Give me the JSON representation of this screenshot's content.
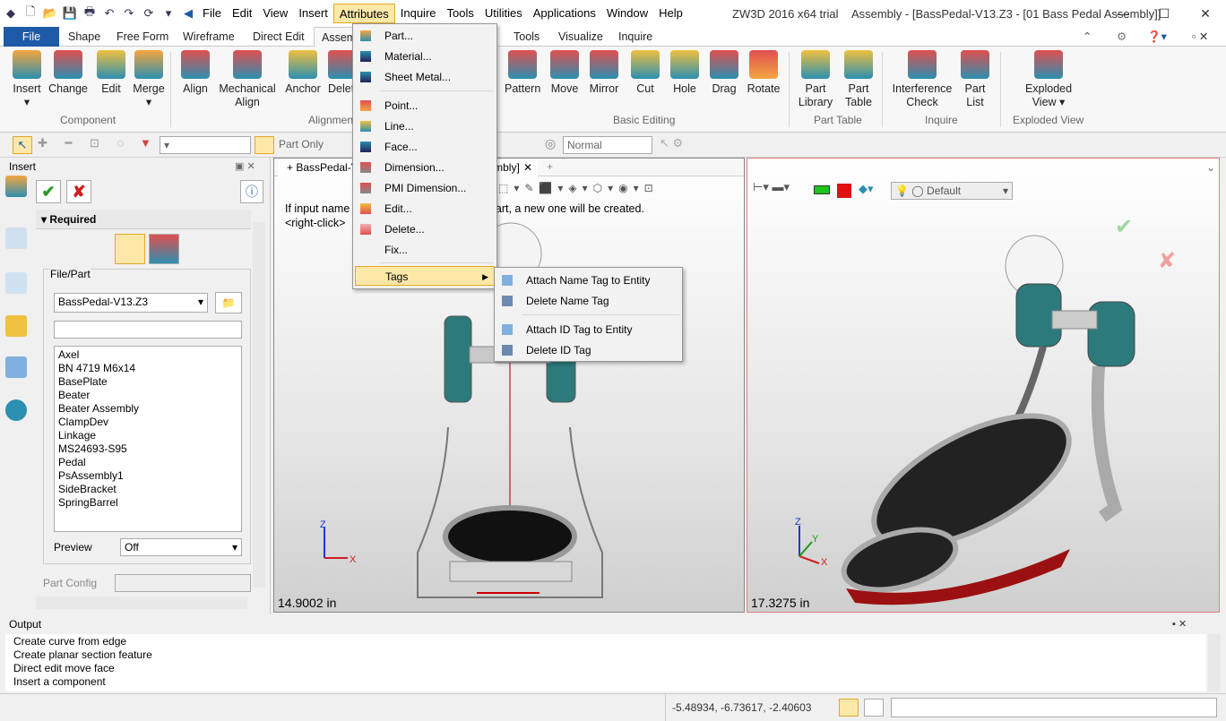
{
  "titlebar": {
    "menu": [
      "File",
      "Edit",
      "View",
      "Insert",
      "Attributes",
      "Inquire",
      "Tools",
      "Utilities",
      "Applications",
      "Window",
      "Help"
    ],
    "title": "ZW3D 2016  x64 trial",
    "doc": "Assembly - [BassPedal-V13.Z3 - [01 Bass Pedal Assembly]]"
  },
  "tabs": [
    "File",
    "Shape",
    "Free Form",
    "Wireframe",
    "Direct Edit",
    "Assembly",
    "Tools",
    "Visualize",
    "Inquire"
  ],
  "ribbon": {
    "component": [
      "Insert",
      "Change",
      "Edit",
      "Merge"
    ],
    "alignment": [
      "Align",
      "Mechanical Align",
      "Anchor",
      "Delete"
    ],
    "basic": [
      "Pattern",
      "Move",
      "Mirror",
      "Cut",
      "Hole",
      "Drag",
      "Rotate"
    ],
    "parttable": [
      "Part Library",
      "Part Table"
    ],
    "inquire": [
      "Interference Check",
      "Part List"
    ],
    "exploded": [
      "Exploded View"
    ],
    "groups": {
      "component": "Component",
      "alignment": "Alignment",
      "basic": "Basic Editing",
      "parttable": "Part Table",
      "inquire": "Inquire",
      "exploded": "Exploded View"
    }
  },
  "toolbar": {
    "partonly": "Part Only",
    "normal": "Normal",
    "default": "Default"
  },
  "panel": {
    "title": "Insert",
    "required": "Required",
    "filepart": "File/Part",
    "file": "BassPedal-V13.Z3",
    "parts": [
      "Axel",
      "BN 4719 M6x14",
      "BasePlate",
      "Beater",
      "Beater Assembly",
      "ClampDev",
      "Linkage",
      "MS24693-S95",
      "Pedal",
      "PsAssembly1",
      "SideBracket",
      "SpringBarrel"
    ],
    "preview_label": "Preview",
    "preview_value": "Off",
    "partconfig": "Part Config"
  },
  "viewport": {
    "tab": "BassPedal-V13.Z3 - [01 Bass Pedal Assembly]",
    "hint": "If input name does not match an existing part, a new one will be created.",
    "hint2": "<right-click>",
    "left_scale": "14.9002 in",
    "right_scale": "17.3275 in"
  },
  "menu": {
    "items": [
      "Part...",
      "Material...",
      "Sheet Metal...",
      "Point...",
      "Line...",
      "Face...",
      "Dimension...",
      "PMI Dimension...",
      "Edit...",
      "Delete...",
      "Fix...",
      "Tags"
    ],
    "submenu": [
      "Attach Name Tag to Entity",
      "Delete Name Tag",
      "Attach ID Tag to Entity",
      "Delete ID Tag"
    ]
  },
  "output": {
    "title": "Output",
    "lines": [
      "Create curve from edge",
      "Create planar section feature",
      "Direct edit move face",
      "Insert a component"
    ]
  },
  "status": {
    "coords": "-5.48934, -6.73617, -2.40603"
  },
  "colors": {
    "accent": "#1e5aa8",
    "highlight": "#fde8a8",
    "teal": "#2c7a7c"
  }
}
